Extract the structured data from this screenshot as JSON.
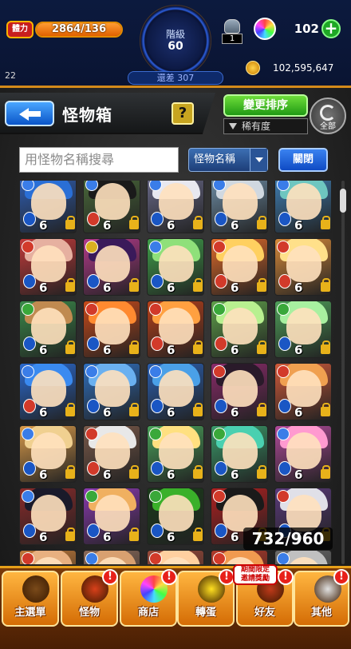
{
  "status": {
    "stamina_label": "體力",
    "stamina_text": "2864/136",
    "stamina_fill_fraction": 1.0,
    "rank_label": "階級",
    "rank_value": "60",
    "exp_text": "還差 307",
    "left_num": "22",
    "item_count": "1",
    "orb_count": "102",
    "plus_label": "+",
    "gold": "102,595,647"
  },
  "header": {
    "title": "怪物箱",
    "help_label": "?",
    "sort_button": "變更排序",
    "sort_value": "稀有度",
    "all_label": "全部"
  },
  "search": {
    "placeholder": "用怪物名稱搜尋",
    "name_select": "怪物名稱",
    "close_label": "關閉"
  },
  "grid": {
    "counter": "732/960",
    "cards": [
      {
        "num": "6",
        "bg": "#2f5fb5",
        "hair": "#2a6fd6",
        "attr": "#3a7de8",
        "elem": "#1a56c4"
      },
      {
        "num": "6",
        "bg": "#4a6a3a",
        "hair": "#1a1a1a",
        "attr": "#3a7de8",
        "elem": "#d23a2a"
      },
      {
        "num": "6",
        "bg": "#6a6a8a",
        "hair": "#e8e8f0",
        "attr": "#3a7de8",
        "elem": "#1a56c4"
      },
      {
        "num": "6",
        "bg": "#6f8fa8",
        "hair": "#d0d8e0",
        "attr": "#3a7de8",
        "elem": "#1a56c4"
      },
      {
        "num": "6",
        "bg": "#3f7fb5",
        "hair": "#6ec6c0",
        "attr": "#3a7de8",
        "elem": "#1a56c4"
      },
      {
        "num": "6",
        "bg": "#c23a3a",
        "hair": "#e6b0a0",
        "attr": "#d23a2a",
        "elem": "#1a56c4"
      },
      {
        "num": "6",
        "bg": "#b23a8a",
        "hair": "#3a1a5a",
        "attr": "#d8b020",
        "elem": "#1a56c4"
      },
      {
        "num": "6",
        "bg": "#3f9f4a",
        "hair": "#8fe07a",
        "attr": "#3a7de8",
        "elem": "#1a56c4"
      },
      {
        "num": "6",
        "bg": "#e06a2a",
        "hair": "#ffd060",
        "attr": "#d23a2a",
        "elem": "#d23a2a"
      },
      {
        "num": "6",
        "bg": "#d88a3a",
        "hair": "#ffe08a",
        "attr": "#d23a2a",
        "elem": "#d23a2a"
      },
      {
        "num": "6",
        "bg": "#3a8a4a",
        "hair": "#c08a50",
        "attr": "#3aa83a",
        "elem": "#1a56c4"
      },
      {
        "num": "6",
        "bg": "#c84a1a",
        "hair": "#ff8a30",
        "attr": "#d23a2a",
        "elem": "#1a56c4"
      },
      {
        "num": "6",
        "bg": "#b8401a",
        "hair": "#ffa040",
        "attr": "#d23a2a",
        "elem": "#d23a2a"
      },
      {
        "num": "6",
        "bg": "#5fa04a",
        "hair": "#b8f090",
        "attr": "#3aa83a",
        "elem": "#d23a2a"
      },
      {
        "num": "6",
        "bg": "#4fa05a",
        "hair": "#a8f0a0",
        "attr": "#3aa83a",
        "elem": "#1a56c4"
      },
      {
        "num": "6",
        "bg": "#2a6ad0",
        "hair": "#3a8af0",
        "attr": "#3a7de8",
        "elem": "#d23a2a"
      },
      {
        "num": "6",
        "bg": "#2f70c0",
        "hair": "#6ab0f0",
        "attr": "#3a7de8",
        "elem": "#1a56c4"
      },
      {
        "num": "6",
        "bg": "#2a5fb0",
        "hair": "#4aa0e8",
        "attr": "#3a7de8",
        "elem": "#1a56c4"
      },
      {
        "num": "6",
        "bg": "#8a2a6a",
        "hair": "#2a1a2a",
        "attr": "#d23a2a",
        "elem": "#1a56c4"
      },
      {
        "num": "6",
        "bg": "#d05a3a",
        "hair": "#f0a050",
        "attr": "#d23a2a",
        "elem": "#1a56c4"
      },
      {
        "num": "6",
        "bg": "#d89a4a",
        "hair": "#f0d090",
        "attr": "#3a7de8",
        "elem": "#1a56c4"
      },
      {
        "num": "6",
        "bg": "#7a5a4a",
        "hair": "#e8e8e8",
        "attr": "#d23a2a",
        "elem": "#d23a2a"
      },
      {
        "num": "6",
        "bg": "#4aa05a",
        "hair": "#ffe080",
        "attr": "#3aa83a",
        "elem": "#1a56c4"
      },
      {
        "num": "6",
        "bg": "#3a9a6a",
        "hair": "#4ad0b0",
        "attr": "#3aa83a",
        "elem": "#1a56c4"
      },
      {
        "num": "6",
        "bg": "#b04a9a",
        "hair": "#ff9ad0",
        "attr": "#3a7de8",
        "elem": "#1a56c4"
      },
      {
        "num": "6",
        "bg": "#8a2a2a",
        "hair": "#1a1a2a",
        "attr": "#3a7de8",
        "elem": "#1a56c4"
      },
      {
        "num": "6",
        "bg": "#8a3ab0",
        "hair": "#f0b060",
        "attr": "#3aa83a",
        "elem": "#1a56c4"
      },
      {
        "num": "6",
        "bg": "#1a3a1a",
        "hair": "#3ab02a",
        "attr": "#3aa83a",
        "elem": "#1a56c4"
      },
      {
        "num": "6",
        "bg": "#b02020",
        "hair": "#1a1a1a",
        "attr": "#d23a2a",
        "elem": "#1a56c4"
      },
      {
        "num": "6",
        "bg": "#5a3a7a",
        "hair": "#e0e0e8",
        "attr": "#d23a2a",
        "elem": "#1a56c4"
      },
      {
        "num": "",
        "bg": "#c07a3a",
        "hair": "#e8b080",
        "attr": "#d23a2a",
        "elem": "#1a56c4"
      },
      {
        "num": "",
        "bg": "#8a6a5a",
        "hair": "#d8a070",
        "attr": "#3a7de8",
        "elem": "#1a56c4"
      },
      {
        "num": "",
        "bg": "#9a4a3a",
        "hair": "#ffd0a0",
        "attr": "#d23a2a",
        "elem": "#1a56c4"
      },
      {
        "num": "",
        "bg": "#b03a2a",
        "hair": "#f09a50",
        "attr": "#d23a2a",
        "elem": "#1a56c4"
      },
      {
        "num": "",
        "bg": "#6a6a6a",
        "hair": "#c0c0c0",
        "attr": "#3a7de8",
        "elem": "#1a56c4"
      }
    ]
  },
  "nav": {
    "items": [
      {
        "label": "主選單",
        "icon": "home-icon",
        "color": "#7a4a1a",
        "badge": ""
      },
      {
        "label": "怪物",
        "icon": "monster-icon",
        "color": "#d8401a",
        "badge": "!"
      },
      {
        "label": "商店",
        "icon": "orb-icon",
        "color": "#ff3ad0",
        "badge": "!"
      },
      {
        "label": "轉蛋",
        "icon": "gacha-icon",
        "color": "#ffe020",
        "badge": "!"
      },
      {
        "label": "好友",
        "icon": "friends-icon",
        "color": "#c03a1a",
        "badge": "!"
      },
      {
        "label": "其他",
        "icon": "other-icon",
        "color": "#e0e0e0",
        "badge": "!"
      }
    ],
    "promo": "期間限定\n邀請獎勵"
  }
}
